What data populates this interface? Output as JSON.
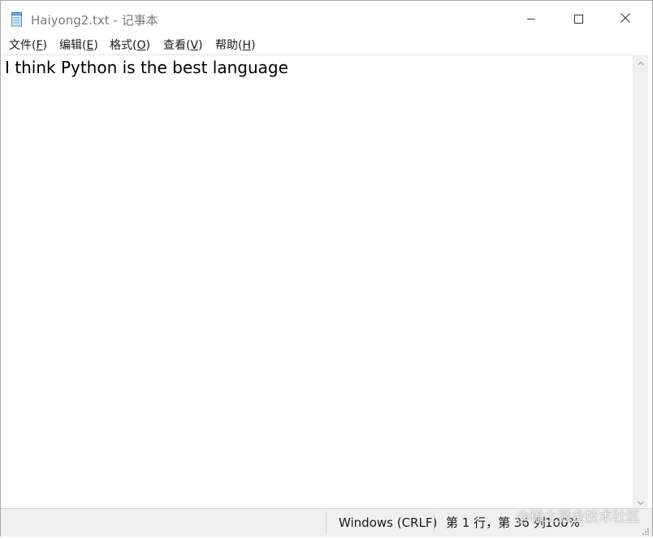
{
  "window": {
    "title": "Haiyong2.txt - 记事本"
  },
  "menu": {
    "items": [
      {
        "label": "文件(",
        "accel": "F",
        "tail": ")"
      },
      {
        "label": "编辑(",
        "accel": "E",
        "tail": ")"
      },
      {
        "label": "格式(",
        "accel": "O",
        "tail": ")"
      },
      {
        "label": "查看(",
        "accel": "V",
        "tail": ")"
      },
      {
        "label": "帮助(",
        "accel": "H",
        "tail": ")"
      }
    ]
  },
  "editor": {
    "content": "I think Python is the best language"
  },
  "status": {
    "encoding": "Windows (CRLF)",
    "position": "第 1 行，第 36 列",
    "zoom": "100%"
  },
  "watermark": {
    "text": "@稀土掘金技术社区"
  },
  "colors": {
    "title_text": "#7a7a7a",
    "statusbar_bg": "#f0f0f0",
    "scrollbar_bg": "#f0f0f0"
  },
  "icons": {
    "app": "notepad-icon",
    "minimize": "minimize-icon",
    "maximize": "maximize-icon",
    "close": "close-icon",
    "scroll_up": "chevron-up-icon",
    "scroll_down": "chevron-down-icon",
    "grip": "resize-grip-icon"
  }
}
